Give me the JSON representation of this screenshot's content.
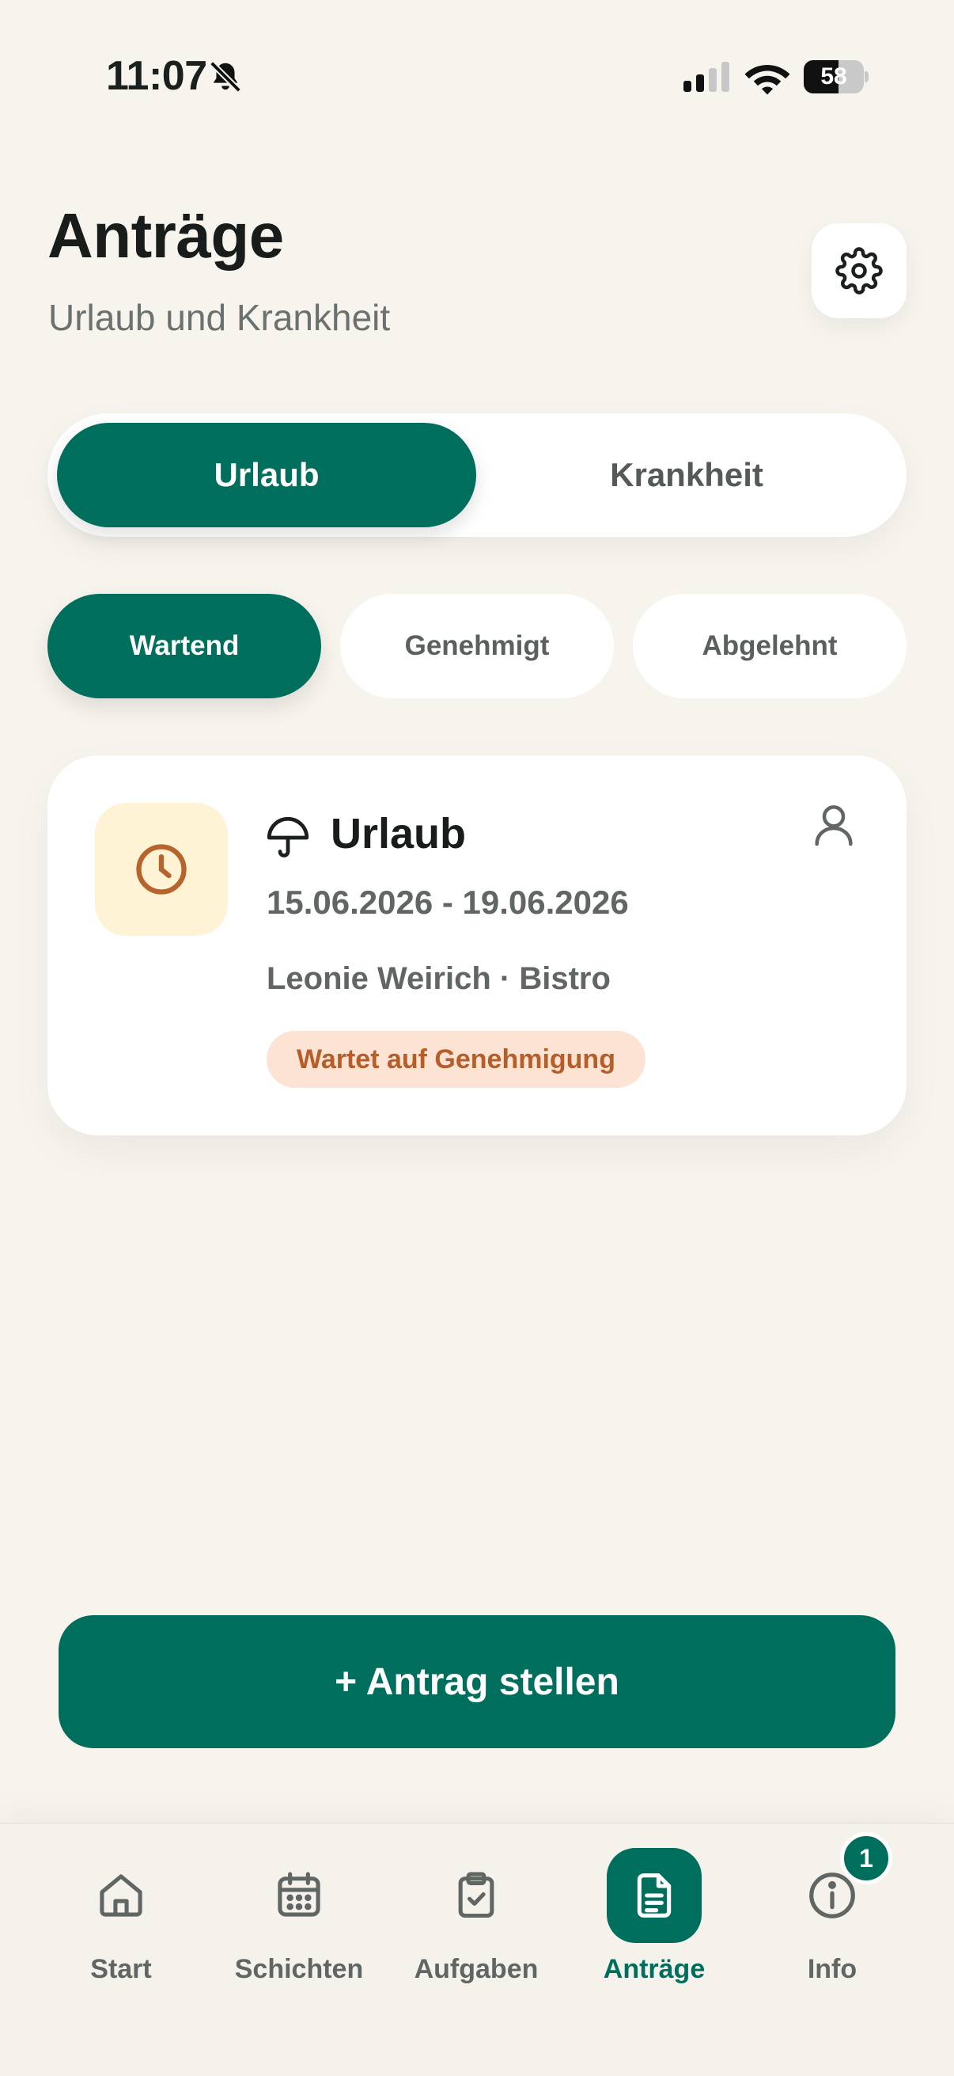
{
  "status_bar": {
    "time": "11:07",
    "battery_level": "58",
    "battery_fraction": 0.58,
    "icons": [
      "bell-off-icon",
      "signal-icon",
      "wifi-icon",
      "battery-icon"
    ]
  },
  "header": {
    "title": "Anträge",
    "subtitle": "Urlaub und Krankheit",
    "settings_icon": "gear-icon"
  },
  "segment": {
    "items": [
      {
        "label": "Urlaub",
        "active": true
      },
      {
        "label": "Krankheit",
        "active": false
      }
    ]
  },
  "filters": {
    "items": [
      {
        "label": "Wartend",
        "active": true
      },
      {
        "label": "Genehmigt",
        "active": false
      },
      {
        "label": "Abgelehnt",
        "active": false
      }
    ]
  },
  "requests": [
    {
      "status_icon": "clock-icon",
      "type_icon": "umbrella-icon",
      "title": "Urlaub",
      "dates": "15.06.2026 - 19.06.2026",
      "person": "Leonie Weirich · Bistro",
      "badge": "Wartet auf Genehmigung",
      "owner_icon": "user-icon"
    }
  ],
  "cta": {
    "label": "+ Antrag stellen"
  },
  "tabbar": {
    "items": [
      {
        "label": "Start",
        "icon": "home-icon",
        "active": false
      },
      {
        "label": "Schichten",
        "icon": "calendar-icon",
        "active": false
      },
      {
        "label": "Aufgaben",
        "icon": "clipboard-check-icon",
        "active": false
      },
      {
        "label": "Anträge",
        "icon": "document-icon",
        "active": true
      },
      {
        "label": "Info",
        "icon": "info-icon",
        "active": false
      }
    ],
    "info_badge": "1"
  },
  "colors": {
    "primary": "#006e5c",
    "background": "#f7f4ee",
    "pending_bg": "#fde3d4",
    "pending_text": "#b65e2a",
    "clock_bg": "#fff3d6",
    "clock_stroke": "#b6632c"
  }
}
